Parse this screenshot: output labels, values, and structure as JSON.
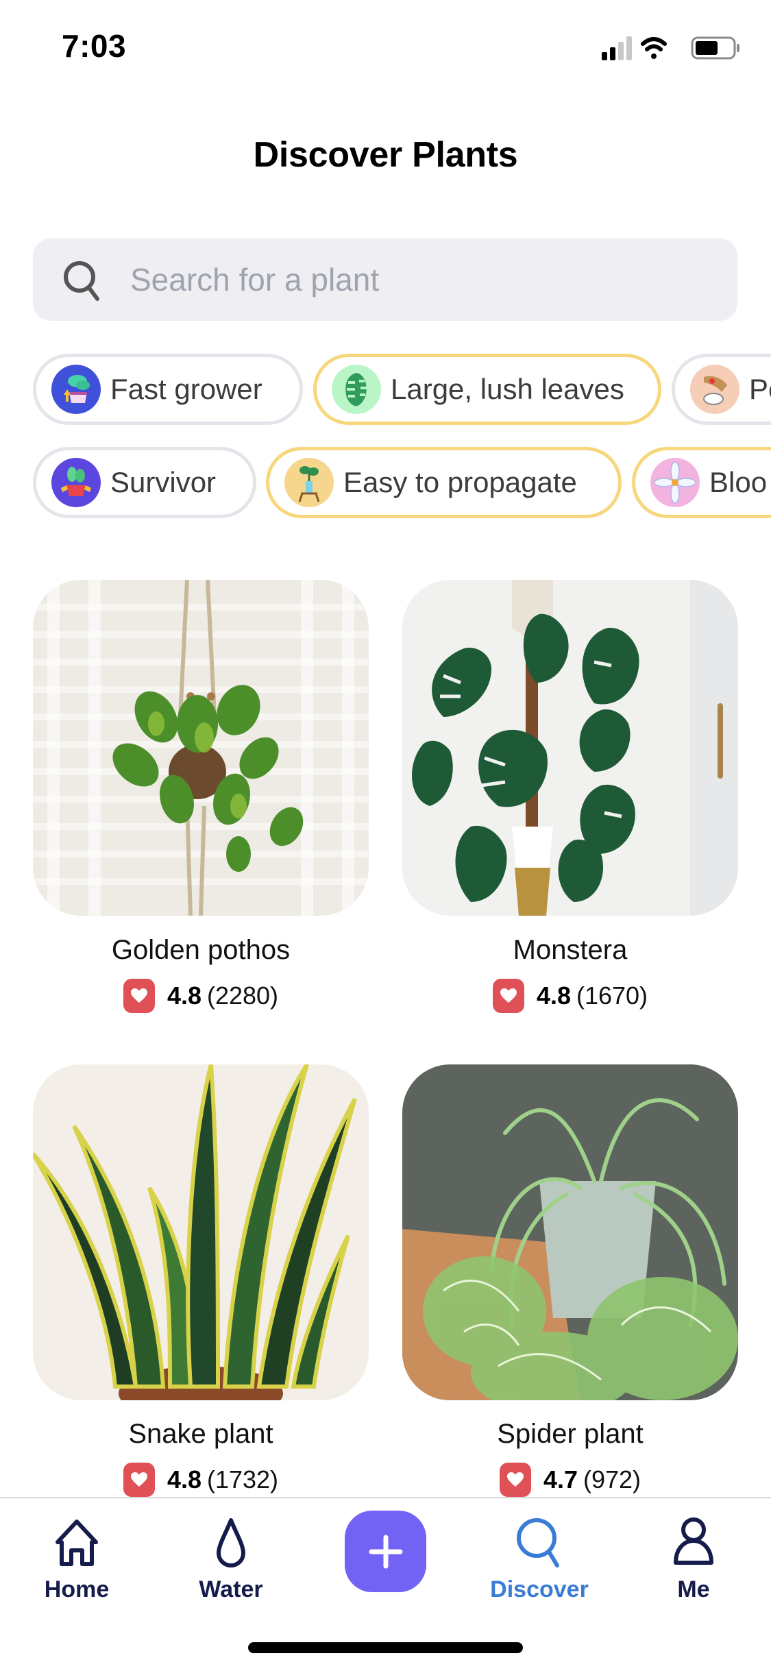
{
  "status_bar": {
    "time": "7:03",
    "icons": [
      "cellular-signal-icon",
      "wifi-icon",
      "battery-icon"
    ]
  },
  "header": {
    "title": "Discover Plants"
  },
  "search": {
    "icon": "search-icon",
    "value": "",
    "placeholder": "Search for a plant"
  },
  "filters": {
    "row1": [
      {
        "label": "Fast grower",
        "icon": "fast-grower-icon",
        "icon_bg": "#3f51d9",
        "featured": false
      },
      {
        "label": "Large, lush leaves",
        "icon": "monstera-leaf-icon",
        "icon_bg": "#b9f5c6",
        "featured": true
      },
      {
        "label": "Pe",
        "icon": "pet-friendly-icon",
        "icon_bg": "#f6cdb6",
        "featured": false
      }
    ],
    "row2": [
      {
        "label": "Survivor",
        "icon": "survivor-icon",
        "icon_bg": "#5b46e0",
        "featured": false
      },
      {
        "label": "Easy to propagate",
        "icon": "propagate-icon",
        "icon_bg": "#f6d58c",
        "featured": true
      },
      {
        "label": "Bloo",
        "icon": "blooming-flower-icon",
        "icon_bg": "#f2b3df",
        "featured": true
      }
    ]
  },
  "plants": [
    {
      "name": "Golden pothos",
      "rating": "4.8",
      "reviews": "(2280)"
    },
    {
      "name": "Monstera",
      "rating": "4.8",
      "reviews": "(1670)"
    },
    {
      "name": "Snake plant",
      "rating": "4.8",
      "reviews": "(1732)"
    },
    {
      "name": "Spider plant",
      "rating": "4.7",
      "reviews": "(972)"
    }
  ],
  "tab_bar": {
    "tabs": [
      {
        "label": "Home",
        "icon": "home-icon",
        "active": false
      },
      {
        "label": "Water",
        "icon": "water-drop-icon",
        "active": false
      },
      {
        "label": "Discover",
        "icon": "search-icon",
        "active": true
      },
      {
        "label": "Me",
        "icon": "person-icon",
        "active": false
      }
    ],
    "add_button_icon": "plus-icon"
  },
  "colors": {
    "accent_purple": "#7363f5",
    "active_tab_blue": "#3a7bd5",
    "tab_navy": "#151b4a",
    "heart_red": "#e05157",
    "featured_border": "#f6d77d",
    "chip_border": "#e4e5ea",
    "search_bg": "#eeeef3"
  }
}
